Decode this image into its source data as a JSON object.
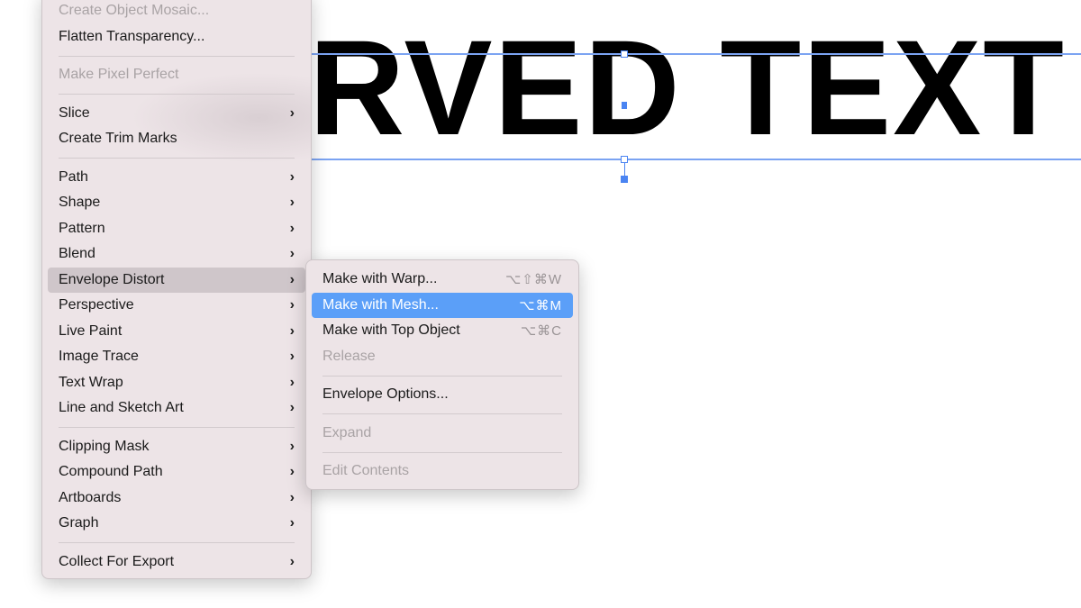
{
  "canvas": {
    "text": "RVED TEXT"
  },
  "colors": {
    "selection": "#4a84f2",
    "highlight": "#5b9ff8",
    "menu_bg": "#ede4e7"
  },
  "main_menu": [
    {
      "label": "Create Object Mosaic...",
      "disabled": true
    },
    {
      "label": "Flatten Transparency..."
    },
    {
      "separator": true
    },
    {
      "label": "Make Pixel Perfect",
      "disabled": true
    },
    {
      "separator": true
    },
    {
      "label": "Slice",
      "submenu": true
    },
    {
      "label": "Create Trim Marks"
    },
    {
      "separator": true
    },
    {
      "label": "Path",
      "submenu": true
    },
    {
      "label": "Shape",
      "submenu": true
    },
    {
      "label": "Pattern",
      "submenu": true
    },
    {
      "label": "Blend",
      "submenu": true
    },
    {
      "label": "Envelope Distort",
      "submenu": true,
      "active": true
    },
    {
      "label": "Perspective",
      "submenu": true
    },
    {
      "label": "Live Paint",
      "submenu": true
    },
    {
      "label": "Image Trace",
      "submenu": true
    },
    {
      "label": "Text Wrap",
      "submenu": true
    },
    {
      "label": "Line and Sketch Art",
      "submenu": true
    },
    {
      "separator": true
    },
    {
      "label": "Clipping Mask",
      "submenu": true
    },
    {
      "label": "Compound Path",
      "submenu": true
    },
    {
      "label": "Artboards",
      "submenu": true
    },
    {
      "label": "Graph",
      "submenu": true
    },
    {
      "separator": true
    },
    {
      "label": "Collect For Export",
      "submenu": true
    }
  ],
  "submenu_chevron": "›",
  "sub_menu": [
    {
      "label": "Make with Warp...",
      "shortcut": "⌥⇧⌘W"
    },
    {
      "label": "Make with Mesh...",
      "shortcut": "⌥⌘M",
      "highlighted": true
    },
    {
      "label": "Make with Top Object",
      "shortcut": "⌥⌘C"
    },
    {
      "label": "Release",
      "disabled": true
    },
    {
      "separator": true
    },
    {
      "label": "Envelope Options..."
    },
    {
      "separator": true
    },
    {
      "label": "Expand",
      "disabled": true
    },
    {
      "separator": true
    },
    {
      "label": "Edit Contents",
      "disabled": true
    }
  ]
}
